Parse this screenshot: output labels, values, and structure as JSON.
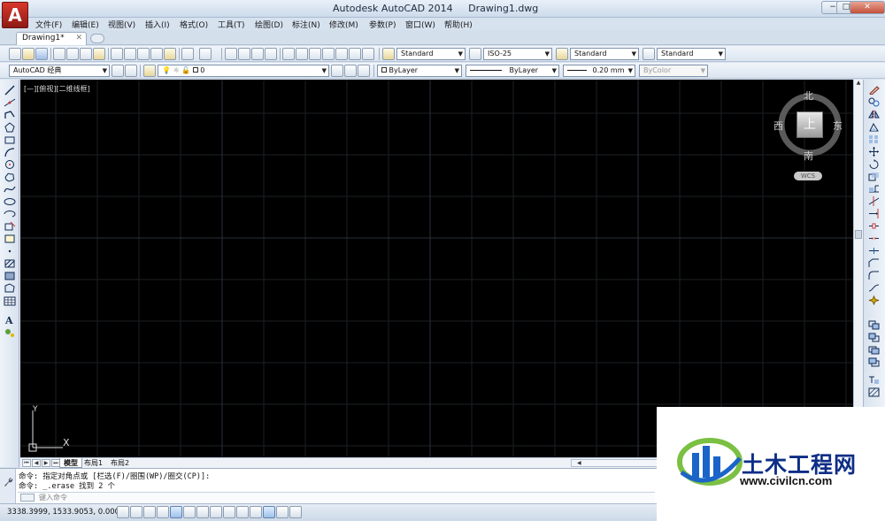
{
  "app": {
    "title": "Autodesk AutoCAD 2014",
    "document": "Drawing1.dwg",
    "logo_letter": "A",
    "window_buttons": [
      "−",
      "□",
      "✕"
    ]
  },
  "menu": [
    "文件(F)",
    "编辑(E)",
    "视图(V)",
    "插入(I)",
    "格式(O)",
    "工具(T)",
    "绘图(D)",
    "标注(N)",
    "修改(M)",
    "参数(P)",
    "窗口(W)",
    "帮助(H)"
  ],
  "doc_tab": {
    "label": "Drawing1*",
    "close": "✕"
  },
  "toolbar1": {
    "text_style": "Standard",
    "dim_style": "ISO-25",
    "table_style": "Standard",
    "mleader_style": "Standard"
  },
  "toolbar2": {
    "workspace": "AutoCAD 经典",
    "layer": "0",
    "color": "ByLayer",
    "linetype": "ByLayer",
    "lineweight": "0.20 mm",
    "plot_style": "ByColor"
  },
  "viewport": {
    "label": "[—][俯视][二维线框]",
    "viewcube": {
      "north": "北",
      "south": "南",
      "east": "东",
      "west": "西",
      "top": "上",
      "wcs": "WCS"
    },
    "ucs": {
      "x": "X",
      "y": "Y"
    }
  },
  "layout_tabs": [
    "模型",
    "布局1",
    "布局2"
  ],
  "command": {
    "lines": [
      "命令: 指定对角点或 [栏选(F)/圈围(WP)/圈交(CP)]:",
      "命令: _.erase 找到 2 个"
    ],
    "placeholder": "键入命令"
  },
  "status": {
    "coordinates": "3338.3999, 1533.9053, 0.0000"
  },
  "watermark": {
    "title": "土木工程网",
    "url": "www.civilcn.com"
  },
  "colors": {
    "background": "#000000",
    "accent": "#1b64c8",
    "logo_red": "#c0281c"
  }
}
